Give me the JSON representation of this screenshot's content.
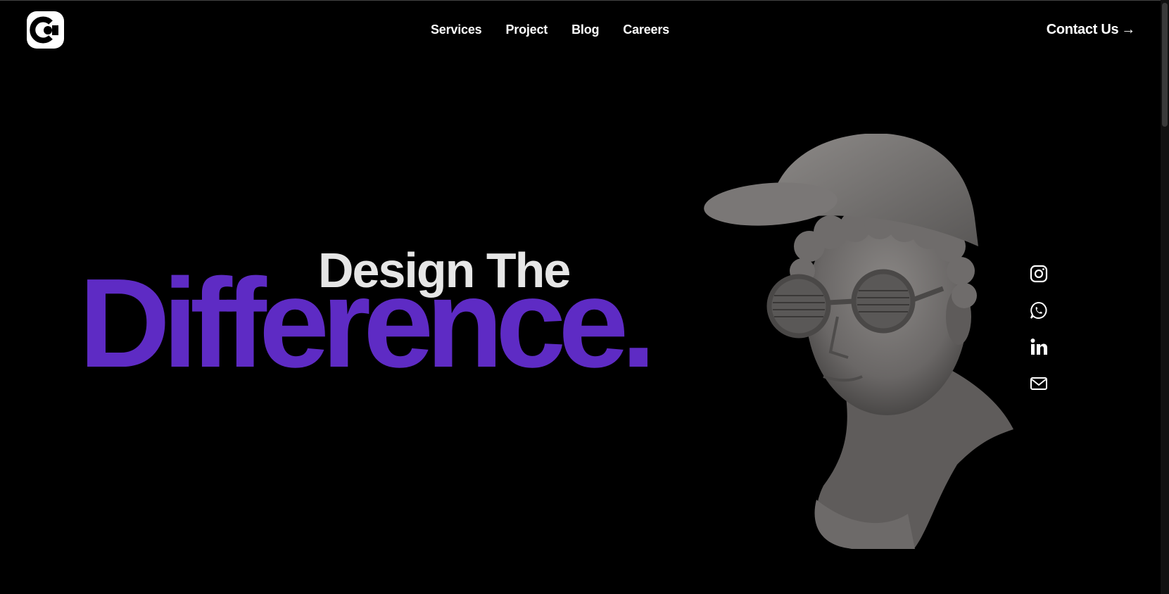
{
  "brand": {
    "logo_icon": "brand-logo-icon"
  },
  "nav": {
    "items": [
      {
        "label": "Services"
      },
      {
        "label": "Project"
      },
      {
        "label": "Blog"
      },
      {
        "label": "Careers"
      }
    ]
  },
  "header": {
    "contact_label": "Contact Us",
    "contact_arrow": "→"
  },
  "hero": {
    "line1": "Design The",
    "line2": "Difference.",
    "image": "statue-bust-with-cap-and-glasses"
  },
  "social": {
    "icons": [
      "instagram-icon",
      "whatsapp-icon",
      "linkedin-icon",
      "mail-icon"
    ]
  },
  "colors": {
    "background": "#000000",
    "accent": "#5e2bc4",
    "text": "#ffffff",
    "subtext": "#e6e6e6"
  }
}
